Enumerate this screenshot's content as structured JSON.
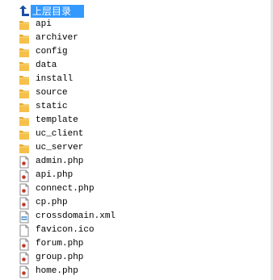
{
  "explorer": {
    "up": {
      "label": "上层目录",
      "icon": "up-arrow-icon"
    },
    "folders": [
      {
        "name": "api",
        "icon": "folder-icon"
      },
      {
        "name": "archiver",
        "icon": "folder-icon"
      },
      {
        "name": "config",
        "icon": "folder-icon"
      },
      {
        "name": "data",
        "icon": "folder-icon"
      },
      {
        "name": "install",
        "icon": "folder-icon"
      },
      {
        "name": "source",
        "icon": "folder-icon"
      },
      {
        "name": "static",
        "icon": "folder-icon"
      },
      {
        "name": "template",
        "icon": "folder-icon"
      },
      {
        "name": "uc_client",
        "icon": "folder-icon"
      },
      {
        "name": "uc_server",
        "icon": "folder-icon"
      }
    ],
    "files": [
      {
        "name": "admin.php",
        "icon": "php-file-icon"
      },
      {
        "name": "api.php",
        "icon": "php-file-icon"
      },
      {
        "name": "connect.php",
        "icon": "php-file-icon"
      },
      {
        "name": "cp.php",
        "icon": "php-file-icon"
      },
      {
        "name": "crossdomain.xml",
        "icon": "xml-file-icon"
      },
      {
        "name": "favicon.ico",
        "icon": "blank-file-icon"
      },
      {
        "name": "forum.php",
        "icon": "php-file-icon"
      },
      {
        "name": "group.php",
        "icon": "php-file-icon"
      },
      {
        "name": "home.php",
        "icon": "php-file-icon"
      }
    ]
  },
  "colors": {
    "selection": "#3399ff",
    "folder": "#f6c04a",
    "arrow": "#1a4fa0"
  }
}
